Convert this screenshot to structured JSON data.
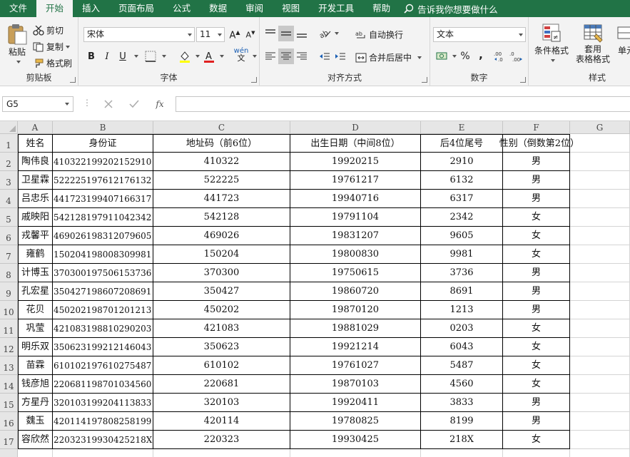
{
  "menu": {
    "tabs": [
      "文件",
      "开始",
      "插入",
      "页面布局",
      "公式",
      "数据",
      "审阅",
      "视图",
      "开发工具",
      "帮助"
    ],
    "active_index": 1,
    "tell_me": "告诉我你想要做什么"
  },
  "ribbon": {
    "clipboard": {
      "label": "剪贴板",
      "paste": "粘贴",
      "cut": "剪切",
      "copy": "复制",
      "format_painter": "格式刷"
    },
    "font": {
      "label": "字体",
      "font_name": "宋体",
      "font_size": "11",
      "bold": "B",
      "italic": "I",
      "underline": "U",
      "wen": "wén"
    },
    "alignment": {
      "label": "对齐方式",
      "wrap_text": "自动换行",
      "merge_center": "合并后居中"
    },
    "number": {
      "label": "数字",
      "format": "文本",
      "percent": "%",
      "comma": ","
    },
    "styles": {
      "label": "样式",
      "conditional": "条件格式",
      "table_format": "套用\n表格格式",
      "cell_styles": "单元"
    }
  },
  "formula_bar": {
    "name_box": "G5",
    "fx": "fx"
  },
  "sheet": {
    "columns": [
      "A",
      "B",
      "C",
      "D",
      "E",
      "F",
      "G"
    ],
    "rows": [
      "1",
      "2",
      "3",
      "4",
      "5",
      "6",
      "7",
      "8",
      "9",
      "10",
      "11",
      "12",
      "13",
      "14",
      "15",
      "16",
      "17",
      "18"
    ],
    "headers": [
      "姓名",
      "身份证",
      "地址码（前6位）",
      "出生日期（中间8位）",
      "后4位尾号",
      "性别（倒数第2位）"
    ],
    "data": [
      [
        "陶伟良",
        "410322199202152910",
        "410322",
        "19920215",
        "2910",
        "男"
      ],
      [
        "卫星霖",
        "522225197612176132",
        "522225",
        "19761217",
        "6132",
        "男"
      ],
      [
        "吕忠乐",
        "441723199407166317",
        "441723",
        "19940716",
        "6317",
        "男"
      ],
      [
        "戚映阳",
        "542128197911042342",
        "542128",
        "19791104",
        "2342",
        "女"
      ],
      [
        "戎馨平",
        "469026198312079605",
        "469026",
        "19831207",
        "9605",
        "女"
      ],
      [
        "雍鹤",
        "150204198008309981",
        "150204",
        "19800830",
        "9981",
        "女"
      ],
      [
        "计博玉",
        "370300197506153736",
        "370300",
        "19750615",
        "3736",
        "男"
      ],
      [
        "孔宏星",
        "350427198607208691",
        "350427",
        "19860720",
        "8691",
        "男"
      ],
      [
        "花贝",
        "450202198701201213",
        "450202",
        "19870120",
        "1213",
        "男"
      ],
      [
        "巩莹",
        "421083198810290203",
        "421083",
        "19881029",
        "0203",
        "女"
      ],
      [
        "明乐双",
        "350623199212146043",
        "350623",
        "19921214",
        "6043",
        "女"
      ],
      [
        "苗霖",
        "610102197610275487",
        "610102",
        "19761027",
        "5487",
        "女"
      ],
      [
        "钱彦旭",
        "220681198701034560",
        "220681",
        "19870103",
        "4560",
        "女"
      ],
      [
        "方星丹",
        "320103199204113833",
        "320103",
        "19920411",
        "3833",
        "男"
      ],
      [
        "魏玉",
        "420114197808258199",
        "420114",
        "19780825",
        "8199",
        "男"
      ],
      [
        "容欣然",
        "22032319930425218X",
        "220323",
        "19930425",
        "218X",
        "女"
      ]
    ]
  },
  "colors": {
    "brand": "#217346",
    "ribbon_bg": "#f3f3f3",
    "header_bg": "#e6e6e6"
  }
}
